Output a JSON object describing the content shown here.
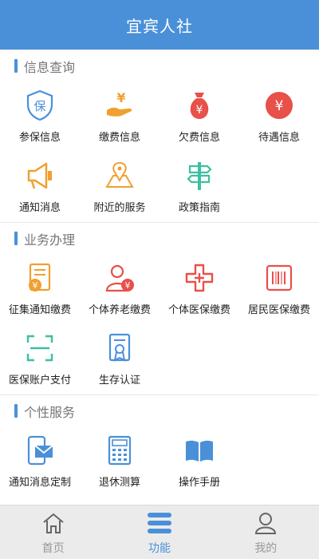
{
  "header": {
    "title": "宜宾人社"
  },
  "colors": {
    "primary": "#4a90d9",
    "orange": "#f0a030",
    "red": "#e8504a",
    "teal": "#3dbfa0"
  },
  "sections": [
    {
      "title": "信息查询",
      "items": [
        {
          "label": "参保信息",
          "icon": "shield-bao-icon",
          "glyph": "保"
        },
        {
          "label": "缴费信息",
          "icon": "hand-yen-icon",
          "glyph": "¥"
        },
        {
          "label": "欠费信息",
          "icon": "money-bag-icon",
          "glyph": "¥"
        },
        {
          "label": "待遇信息",
          "icon": "yen-circle-icon",
          "glyph": "¥"
        },
        {
          "label": "通知消息",
          "icon": "megaphone-icon"
        },
        {
          "label": "附近的服务",
          "icon": "map-pin-icon"
        },
        {
          "label": "政策指南",
          "icon": "signpost-icon"
        }
      ]
    },
    {
      "title": "业务办理",
      "items": [
        {
          "label": "征集通知缴费",
          "icon": "invoice-yen-icon",
          "glyph": "¥"
        },
        {
          "label": "个体养老缴费",
          "icon": "person-yen-icon",
          "glyph": "¥"
        },
        {
          "label": "个体医保缴费",
          "icon": "medical-cross-icon"
        },
        {
          "label": "居民医保缴费",
          "icon": "barcode-card-icon"
        },
        {
          "label": "医保账户支付",
          "icon": "scan-frame-icon"
        },
        {
          "label": "生存认证",
          "icon": "certificate-icon"
        }
      ]
    },
    {
      "title": "个性服务",
      "items": [
        {
          "label": "通知消息定制",
          "icon": "phone-mail-icon"
        },
        {
          "label": "退休测算",
          "icon": "calculator-icon"
        },
        {
          "label": "操作手册",
          "icon": "book-icon"
        }
      ]
    }
  ],
  "tabs": [
    {
      "label": "首页",
      "icon": "home-icon",
      "active": false
    },
    {
      "label": "功能",
      "icon": "menu-list-icon",
      "active": true
    },
    {
      "label": "我的",
      "icon": "user-icon",
      "active": false
    }
  ]
}
